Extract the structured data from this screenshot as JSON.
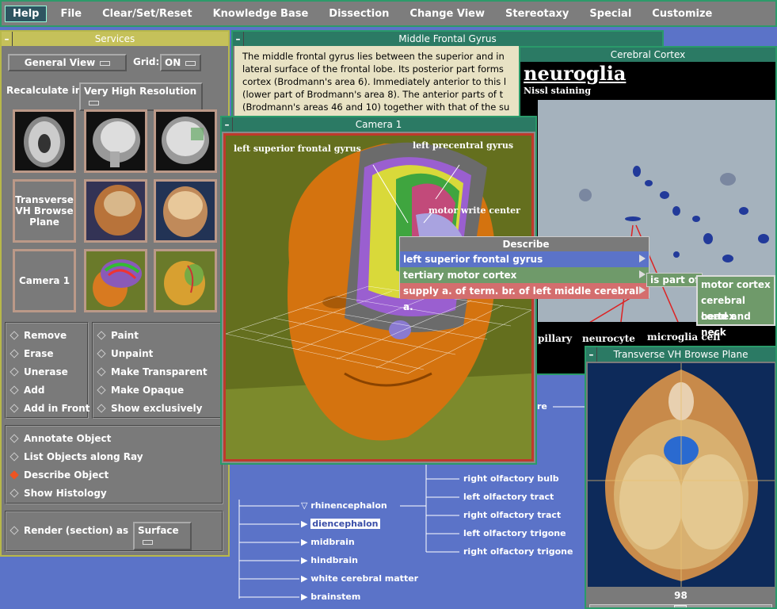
{
  "menubar": {
    "items": [
      "Help",
      "File",
      "Clear/Set/Reset",
      "Knowledge Base",
      "Dissection",
      "Change View",
      "Stereotaxy",
      "Special",
      "Customize"
    ]
  },
  "services": {
    "title": "Services",
    "view_select": "General View",
    "grid_label": "Grid:",
    "grid_value": "ON",
    "recalc_label": "Recalculate in",
    "recalc_value": "Very High Resolution",
    "transverse_btn": "Transverse VH Browse Plane",
    "camera_btn": "Camera 1",
    "actions_left": [
      "Remove",
      "Erase",
      "Unerase",
      "Add",
      "Add in Front"
    ],
    "actions_right": [
      "Paint",
      "Unpaint",
      "Make Transparent",
      "Make Opaque",
      "Show exclusively"
    ],
    "object_ops": [
      "Annotate Object",
      "List Objects along Ray",
      "Describe Object",
      "Show Histology"
    ],
    "selected_op": "Describe Object",
    "render_label": "Render (section) as",
    "render_value": "Surface"
  },
  "mfg": {
    "title": "Middle Frontal Gyrus",
    "lines": [
      "The middle frontal gyrus lies between the superior and in",
      "lateral surface of the frontal lobe.  Its posterior part forms",
      "cortex (Brodmann's area 6).  Immediately anterior to this l",
      "(lower part of Brodmann's area 8).  The anterior parts of t",
      "(Brodmann's areas 46 and 10) together with that of the su"
    ]
  },
  "cortex": {
    "title": "Cerebral Cortex",
    "heading": "neuroglia",
    "sub": "Nissl staining",
    "labels": [
      "pillary",
      "neurocyte",
      "microglia cell"
    ]
  },
  "camera": {
    "title": "Camera 1",
    "labels": [
      "left superior frontal gyrus",
      "left precentral gyrus",
      "motor write center"
    ]
  },
  "describe": {
    "title": "Describe",
    "items": [
      "left superior frontal gyrus",
      "tertiary motor cortex",
      "supply a. of term. br. of left middle cerebral a."
    ],
    "is_part_of": "is part of",
    "parts": [
      "motor cortex",
      "cerebral cortex",
      "head and neck"
    ]
  },
  "tree": {
    "partial": "re",
    "left": [
      "rhinencephalon",
      "diencephalon",
      "midbrain",
      "hindbrain",
      "white cerebral matter",
      "brainstem"
    ],
    "right": [
      "right olfactory bulb",
      "left olfactory tract",
      "right olfactory tract",
      "left olfactory trigone",
      "right olfactory trigone"
    ]
  },
  "tvh": {
    "title": "Transverse VH Browse Plane",
    "slice": "98"
  }
}
